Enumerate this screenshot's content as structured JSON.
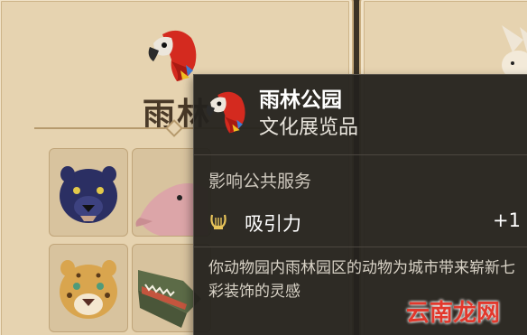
{
  "card": {
    "title": "雨林"
  },
  "tooltip": {
    "title": "雨林公园",
    "subtitle": "文化展览品",
    "section_label": "影响公共服务",
    "effect": {
      "label": "吸引力",
      "value": "+1",
      "icon": "lyre-icon"
    },
    "description": "你动物园内雨林园区的动物为城市带来崭新七彩装饰的灵感"
  },
  "animals": [
    {
      "icon": "panther-icon"
    },
    {
      "icon": "pink-dolphin-icon"
    },
    {
      "icon": "jaguar-icon"
    },
    {
      "icon": "caiman-icon"
    }
  ],
  "watermark": "云南龙网",
  "colors": {
    "card_bg": "#e6d3b0",
    "tooltip_bg": "#24221e",
    "parrot_red": "#d42a1f",
    "watermark_red": "#e2382c"
  }
}
